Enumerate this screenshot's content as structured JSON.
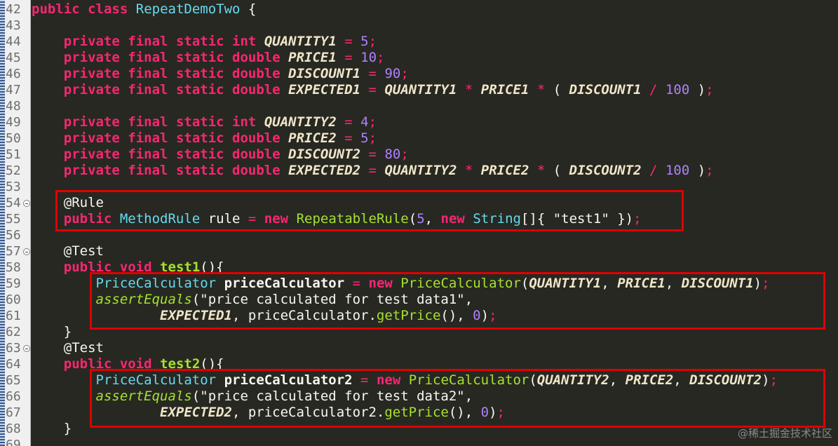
{
  "editor": {
    "lines": [
      {
        "n": "42",
        "fold": false,
        "tokens": [
          [
            "kw",
            "public"
          ],
          [
            "pl",
            " "
          ],
          [
            "kw",
            "class"
          ],
          [
            "pl",
            " "
          ],
          [
            "ty",
            "RepeatDemoTwo"
          ],
          [
            "pl",
            " {"
          ]
        ]
      },
      {
        "n": "43",
        "fold": false,
        "tokens": []
      },
      {
        "n": "44",
        "fold": false,
        "tokens": [
          [
            "pl",
            "    "
          ],
          [
            "kw",
            "private"
          ],
          [
            "pl",
            " "
          ],
          [
            "kw",
            "final"
          ],
          [
            "pl",
            " "
          ],
          [
            "kw",
            "static"
          ],
          [
            "pl",
            " "
          ],
          [
            "kw",
            "int"
          ],
          [
            "pl",
            " "
          ],
          [
            "cn",
            "QUANTITY1"
          ],
          [
            "pl",
            " "
          ],
          [
            "op",
            "="
          ],
          [
            "pl",
            " "
          ],
          [
            "nm",
            "5"
          ],
          [
            "op",
            ";"
          ]
        ]
      },
      {
        "n": "45",
        "fold": false,
        "tokens": [
          [
            "pl",
            "    "
          ],
          [
            "kw",
            "private"
          ],
          [
            "pl",
            " "
          ],
          [
            "kw",
            "final"
          ],
          [
            "pl",
            " "
          ],
          [
            "kw",
            "static"
          ],
          [
            "pl",
            " "
          ],
          [
            "kw",
            "double"
          ],
          [
            "pl",
            " "
          ],
          [
            "cn",
            "PRICE1"
          ],
          [
            "pl",
            " "
          ],
          [
            "op",
            "="
          ],
          [
            "pl",
            " "
          ],
          [
            "nm",
            "10"
          ],
          [
            "op",
            ";"
          ]
        ]
      },
      {
        "n": "46",
        "fold": false,
        "tokens": [
          [
            "pl",
            "    "
          ],
          [
            "kw",
            "private"
          ],
          [
            "pl",
            " "
          ],
          [
            "kw",
            "final"
          ],
          [
            "pl",
            " "
          ],
          [
            "kw",
            "static"
          ],
          [
            "pl",
            " "
          ],
          [
            "kw",
            "double"
          ],
          [
            "pl",
            " "
          ],
          [
            "cn",
            "DISCOUNT1"
          ],
          [
            "pl",
            " "
          ],
          [
            "op",
            "="
          ],
          [
            "pl",
            " "
          ],
          [
            "nm",
            "90"
          ],
          [
            "op",
            ";"
          ]
        ]
      },
      {
        "n": "47",
        "fold": false,
        "tokens": [
          [
            "pl",
            "    "
          ],
          [
            "kw",
            "private"
          ],
          [
            "pl",
            " "
          ],
          [
            "kw",
            "final"
          ],
          [
            "pl",
            " "
          ],
          [
            "kw",
            "static"
          ],
          [
            "pl",
            " "
          ],
          [
            "kw",
            "double"
          ],
          [
            "pl",
            " "
          ],
          [
            "cn",
            "EXPECTED1"
          ],
          [
            "pl",
            " "
          ],
          [
            "op",
            "="
          ],
          [
            "pl",
            " "
          ],
          [
            "cn",
            "QUANTITY1"
          ],
          [
            "pl",
            " "
          ],
          [
            "op",
            "*"
          ],
          [
            "pl",
            " "
          ],
          [
            "cn",
            "PRICE1"
          ],
          [
            "pl",
            " "
          ],
          [
            "op",
            "*"
          ],
          [
            "pl",
            " ( "
          ],
          [
            "cn",
            "DISCOUNT1"
          ],
          [
            "pl",
            " "
          ],
          [
            "op",
            "/"
          ],
          [
            "pl",
            " "
          ],
          [
            "nm",
            "100"
          ],
          [
            "pl",
            " )"
          ],
          [
            "op",
            ";"
          ]
        ]
      },
      {
        "n": "48",
        "fold": false,
        "tokens": []
      },
      {
        "n": "49",
        "fold": false,
        "tokens": [
          [
            "pl",
            "    "
          ],
          [
            "kw",
            "private"
          ],
          [
            "pl",
            " "
          ],
          [
            "kw",
            "final"
          ],
          [
            "pl",
            " "
          ],
          [
            "kw",
            "static"
          ],
          [
            "pl",
            " "
          ],
          [
            "kw",
            "int"
          ],
          [
            "pl",
            " "
          ],
          [
            "cn",
            "QUANTITY2"
          ],
          [
            "pl",
            " "
          ],
          [
            "op",
            "="
          ],
          [
            "pl",
            " "
          ],
          [
            "nm",
            "4"
          ],
          [
            "op",
            ";"
          ]
        ]
      },
      {
        "n": "50",
        "fold": false,
        "tokens": [
          [
            "pl",
            "    "
          ],
          [
            "kw",
            "private"
          ],
          [
            "pl",
            " "
          ],
          [
            "kw",
            "final"
          ],
          [
            "pl",
            " "
          ],
          [
            "kw",
            "static"
          ],
          [
            "pl",
            " "
          ],
          [
            "kw",
            "double"
          ],
          [
            "pl",
            " "
          ],
          [
            "cn",
            "PRICE2"
          ],
          [
            "pl",
            " "
          ],
          [
            "op",
            "="
          ],
          [
            "pl",
            " "
          ],
          [
            "nm",
            "5"
          ],
          [
            "op",
            ";"
          ]
        ]
      },
      {
        "n": "51",
        "fold": false,
        "tokens": [
          [
            "pl",
            "    "
          ],
          [
            "kw",
            "private"
          ],
          [
            "pl",
            " "
          ],
          [
            "kw",
            "final"
          ],
          [
            "pl",
            " "
          ],
          [
            "kw",
            "static"
          ],
          [
            "pl",
            " "
          ],
          [
            "kw",
            "double"
          ],
          [
            "pl",
            " "
          ],
          [
            "cn",
            "DISCOUNT2"
          ],
          [
            "pl",
            " "
          ],
          [
            "op",
            "="
          ],
          [
            "pl",
            " "
          ],
          [
            "nm",
            "80"
          ],
          [
            "op",
            ";"
          ]
        ]
      },
      {
        "n": "52",
        "fold": false,
        "tokens": [
          [
            "pl",
            "    "
          ],
          [
            "kw",
            "private"
          ],
          [
            "pl",
            " "
          ],
          [
            "kw",
            "final"
          ],
          [
            "pl",
            " "
          ],
          [
            "kw",
            "static"
          ],
          [
            "pl",
            " "
          ],
          [
            "kw",
            "double"
          ],
          [
            "pl",
            " "
          ],
          [
            "cn",
            "EXPECTED2"
          ],
          [
            "pl",
            " "
          ],
          [
            "op",
            "="
          ],
          [
            "pl",
            " "
          ],
          [
            "cn",
            "QUANTITY2"
          ],
          [
            "pl",
            " "
          ],
          [
            "op",
            "*"
          ],
          [
            "pl",
            " "
          ],
          [
            "cn",
            "PRICE2"
          ],
          [
            "pl",
            " "
          ],
          [
            "op",
            "*"
          ],
          [
            "pl",
            " ( "
          ],
          [
            "cn",
            "DISCOUNT2"
          ],
          [
            "pl",
            " "
          ],
          [
            "op",
            "/"
          ],
          [
            "pl",
            " "
          ],
          [
            "nm",
            "100"
          ],
          [
            "pl",
            " )"
          ],
          [
            "op",
            ";"
          ]
        ]
      },
      {
        "n": "53",
        "fold": false,
        "tokens": []
      },
      {
        "n": "54",
        "fold": true,
        "tokens": [
          [
            "pl",
            "    "
          ],
          [
            "an",
            "@Rule"
          ]
        ]
      },
      {
        "n": "55",
        "fold": false,
        "tokens": [
          [
            "pl",
            "    "
          ],
          [
            "kw",
            "public"
          ],
          [
            "pl",
            " "
          ],
          [
            "ty",
            "MethodRule"
          ],
          [
            "pl",
            " rule "
          ],
          [
            "op",
            "="
          ],
          [
            "pl",
            " "
          ],
          [
            "kw",
            "new"
          ],
          [
            "pl",
            " "
          ],
          [
            "cl",
            "RepeatableRule"
          ],
          [
            "pl",
            "("
          ],
          [
            "nm",
            "5"
          ],
          [
            "pl",
            ", "
          ],
          [
            "kw",
            "new"
          ],
          [
            "pl",
            " "
          ],
          [
            "ty",
            "String"
          ],
          [
            "pl",
            "[]{ "
          ],
          [
            "st",
            "\"test1\""
          ],
          [
            "pl",
            " })"
          ],
          [
            "op",
            ";"
          ]
        ]
      },
      {
        "n": "56",
        "fold": false,
        "tokens": []
      },
      {
        "n": "57",
        "fold": true,
        "tokens": [
          [
            "pl",
            "    "
          ],
          [
            "an",
            "@Test"
          ]
        ]
      },
      {
        "n": "58",
        "fold": false,
        "tokens": [
          [
            "pl",
            "    "
          ],
          [
            "kw",
            "public"
          ],
          [
            "pl",
            " "
          ],
          [
            "kw",
            "void"
          ],
          [
            "pl",
            " "
          ],
          [
            "fn",
            "test1"
          ],
          [
            "pl",
            "(){"
          ]
        ]
      },
      {
        "n": "59",
        "fold": false,
        "tokens": [
          [
            "pl",
            "        "
          ],
          [
            "ty",
            "PriceCalculator"
          ],
          [
            "pl",
            " "
          ],
          [
            "bold",
            "priceCalculator"
          ],
          [
            "pl",
            " "
          ],
          [
            "op",
            "="
          ],
          [
            "pl",
            " "
          ],
          [
            "kw",
            "new"
          ],
          [
            "pl",
            " "
          ],
          [
            "cl",
            "PriceCalculator"
          ],
          [
            "pl",
            "("
          ],
          [
            "cn",
            "QUANTITY1"
          ],
          [
            "pl",
            ", "
          ],
          [
            "cn",
            "PRICE1"
          ],
          [
            "pl",
            ", "
          ],
          [
            "cn",
            "DISCOUNT1"
          ],
          [
            "pl",
            ")"
          ],
          [
            "op",
            ";"
          ]
        ]
      },
      {
        "n": "60",
        "fold": false,
        "tokens": [
          [
            "pl",
            "        "
          ],
          [
            "it",
            "assertEquals"
          ],
          [
            "pl",
            "("
          ],
          [
            "st",
            "\"price calculated for test data1\""
          ],
          [
            "pl",
            ","
          ]
        ]
      },
      {
        "n": "61",
        "fold": false,
        "tokens": [
          [
            "pl",
            "                "
          ],
          [
            "cn",
            "EXPECTED1"
          ],
          [
            "pl",
            ", priceCalculator."
          ],
          [
            "cl",
            "getPrice"
          ],
          [
            "pl",
            "(), "
          ],
          [
            "nm",
            "0"
          ],
          [
            "pl",
            ")"
          ],
          [
            "op",
            ";"
          ]
        ]
      },
      {
        "n": "62",
        "fold": false,
        "tokens": [
          [
            "pl",
            "    }"
          ]
        ]
      },
      {
        "n": "63",
        "fold": true,
        "tokens": [
          [
            "pl",
            "    "
          ],
          [
            "an",
            "@Test"
          ]
        ]
      },
      {
        "n": "64",
        "fold": false,
        "tokens": [
          [
            "pl",
            "    "
          ],
          [
            "kw",
            "public"
          ],
          [
            "pl",
            " "
          ],
          [
            "kw",
            "void"
          ],
          [
            "pl",
            " "
          ],
          [
            "fn",
            "test2"
          ],
          [
            "pl",
            "(){"
          ]
        ]
      },
      {
        "n": "65",
        "fold": false,
        "tokens": [
          [
            "pl",
            "        "
          ],
          [
            "ty",
            "PriceCalculator"
          ],
          [
            "pl",
            " "
          ],
          [
            "bold",
            "priceCalculator2"
          ],
          [
            "pl",
            " "
          ],
          [
            "op",
            "="
          ],
          [
            "pl",
            " "
          ],
          [
            "kw",
            "new"
          ],
          [
            "pl",
            " "
          ],
          [
            "cl",
            "PriceCalculator"
          ],
          [
            "pl",
            "("
          ],
          [
            "cn",
            "QUANTITY2"
          ],
          [
            "pl",
            ", "
          ],
          [
            "cn",
            "PRICE2"
          ],
          [
            "pl",
            ", "
          ],
          [
            "cn",
            "DISCOUNT2"
          ],
          [
            "pl",
            ")"
          ],
          [
            "op",
            ";"
          ]
        ]
      },
      {
        "n": "66",
        "fold": false,
        "tokens": [
          [
            "pl",
            "        "
          ],
          [
            "it",
            "assertEquals"
          ],
          [
            "pl",
            "("
          ],
          [
            "st",
            "\"price calculated for test data2\""
          ],
          [
            "pl",
            ","
          ]
        ]
      },
      {
        "n": "67",
        "fold": false,
        "tokens": [
          [
            "pl",
            "                "
          ],
          [
            "cn",
            "EXPECTED2"
          ],
          [
            "pl",
            ", priceCalculator2."
          ],
          [
            "cl",
            "getPrice"
          ],
          [
            "pl",
            "(), "
          ],
          [
            "nm",
            "0"
          ],
          [
            "pl",
            ")"
          ],
          [
            "op",
            ";"
          ]
        ]
      },
      {
        "n": "68",
        "fold": false,
        "tokens": [
          [
            "pl",
            "    }"
          ]
        ]
      },
      {
        "n": "69",
        "fold": false,
        "tokens": []
      }
    ]
  },
  "watermark": "@稀土掘金技术社区",
  "colors": {
    "background": "#272822",
    "keyword": "#f92672",
    "type": "#66d9ef",
    "method": "#a6e22e",
    "number": "#ae81ff",
    "highlight_box": "#e00000"
  }
}
